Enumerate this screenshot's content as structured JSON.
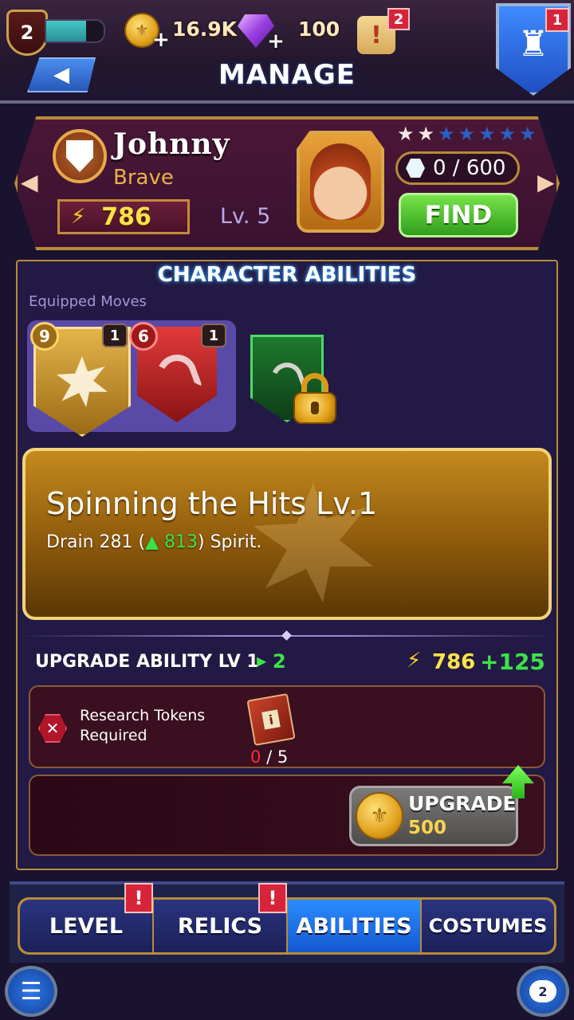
{
  "hud": {
    "player_level": "2",
    "xp_progress": 0.7,
    "coins": "16.9K",
    "gems": "100",
    "quest_badge": "2",
    "home_badge": "1"
  },
  "header": {
    "title": "MANAGE"
  },
  "character": {
    "name": "Johnny",
    "class": "Brave",
    "power": "786",
    "level": "Lv. 5",
    "stars_filled": 2,
    "stars_total": 7,
    "shards": "0 / 600",
    "find_label": "FIND"
  },
  "abilities": {
    "title": "CHARACTER ABILITIES",
    "equipped_label": "Equipped Moves",
    "moves": [
      {
        "cost": "9",
        "level": "1",
        "color": "gold",
        "icon": "burst-icon"
      },
      {
        "cost": "6",
        "level": "1",
        "color": "red",
        "icon": "whip-icon"
      },
      {
        "color": "green",
        "icon": "whip-icon",
        "locked": true
      }
    ],
    "selected": {
      "name": "Spinning the Hits Lv.1",
      "desc_prefix": "Drain 281 (",
      "desc_bonus": "813",
      "desc_suffix": ") Spirit."
    },
    "upgrade": {
      "label": "UPGRADE ABILITY LV 1",
      "to_level": "2",
      "power": "786",
      "power_bonus": "+125",
      "requirement": "Research Tokens Required",
      "req_have": "0",
      "req_need": "/ 5",
      "button_label": "UPGRADE",
      "button_cost": "500"
    }
  },
  "tabs": [
    {
      "label": "LEVEL",
      "alert": "!"
    },
    {
      "label": "RELICS",
      "alert": "!"
    },
    {
      "label": "ABILITIES",
      "active": true
    },
    {
      "label": "COSTUMES"
    }
  ],
  "chat_count": "2",
  "colors": {
    "panel_border": "#b88a3a",
    "active_tab": "#2b8cff",
    "accent_green": "#3de24a",
    "power_yellow": "#ffe34a"
  }
}
